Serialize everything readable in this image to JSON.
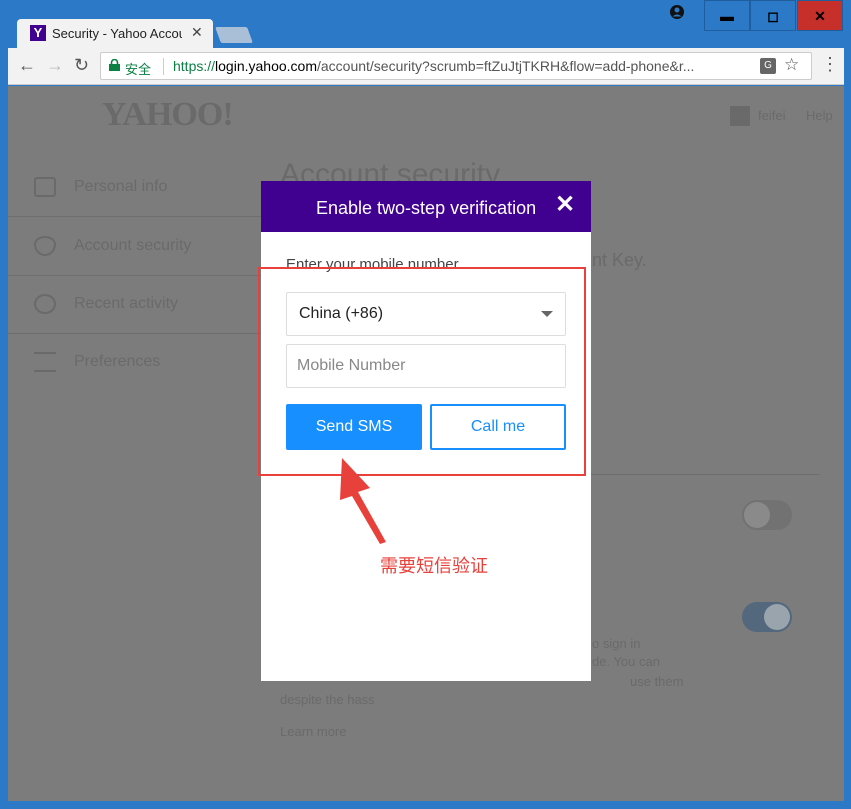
{
  "browser": {
    "tab_title": "Security - Yahoo Accou",
    "tab_favicon": "Y",
    "tab_close": "✕",
    "secure_label": "安全",
    "url_scheme": "https://",
    "url_host": "login.yahoo.com",
    "url_path": "/account/security?scrumb=ftZuJtjTKRH&flow=add-phone&r...",
    "translate_glyph": "G",
    "window_controls": {
      "minimize": "▬",
      "maximize": "◻",
      "close": "✕"
    }
  },
  "page": {
    "logo": "YAHOO!",
    "user_name": "feifei",
    "help": "Help",
    "sidebar": [
      {
        "label": "Personal info",
        "icon": "id-card-icon"
      },
      {
        "label": "Account security",
        "icon": "shield-icon"
      },
      {
        "label": "Recent activity",
        "icon": "clock-icon"
      },
      {
        "label": "Preferences",
        "icon": "list-icon"
      }
    ],
    "bg_title": "Account security",
    "bg_key": "nt Key.",
    "bg_para_1": "o sign in",
    "bg_para_2": "de. You can",
    "bg_para_3": "use them",
    "bg_para_4": "despite the hass",
    "bg_learn_more": "Learn more"
  },
  "modal": {
    "title": "Enable two-step verification",
    "close": "✕",
    "label": "Enter your mobile number",
    "country_value": "China (+86)",
    "mobile_placeholder": "Mobile Number",
    "send_sms": "Send SMS",
    "call_me": "Call me"
  },
  "annotation": {
    "text": "需要短信验证",
    "color": "#e8403a"
  },
  "colors": {
    "yahoo_purple": "#400090",
    "primary_blue": "#188fff",
    "window_blue": "#2b79c7"
  }
}
